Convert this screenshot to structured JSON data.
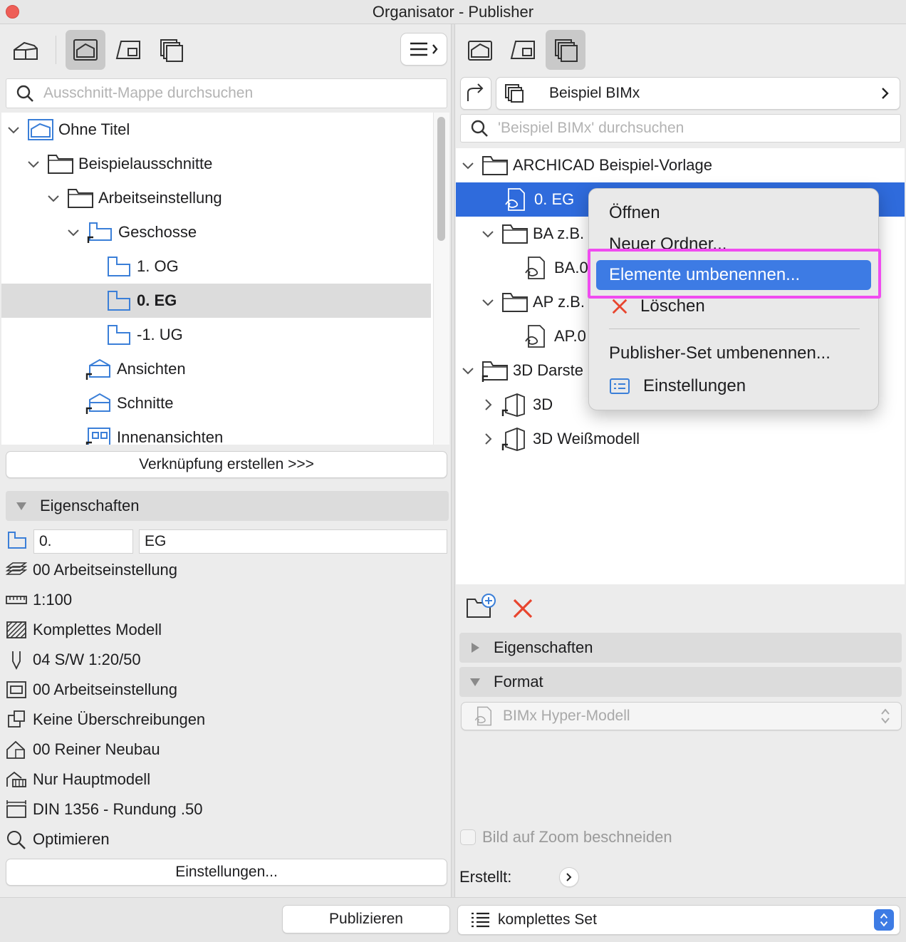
{
  "window": {
    "title": "Organisator - Publisher"
  },
  "left": {
    "search_placeholder": "Ausschnitt-Mappe durchsuchen",
    "tree": [
      {
        "label": "Ohne Titel",
        "level": 0,
        "icon": "project-icon",
        "chevron": "down"
      },
      {
        "label": "Beispielausschnitte",
        "level": 1,
        "icon": "folder-icon",
        "chevron": "down"
      },
      {
        "label": "Arbeitseinstellung",
        "level": 2,
        "icon": "folder-icon",
        "chevron": "down"
      },
      {
        "label": "Geschosse",
        "level": 3,
        "icon": "floorplan-shortcut-icon",
        "chevron": "down"
      },
      {
        "label": "1. OG",
        "level": 4,
        "icon": "floorplan-icon"
      },
      {
        "label": "0. EG",
        "level": 4,
        "icon": "floorplan-icon",
        "selected": true
      },
      {
        "label": "-1. UG",
        "level": 4,
        "icon": "floorplan-icon"
      },
      {
        "label": "Ansichten",
        "level": 3,
        "icon": "elevation-shortcut-icon"
      },
      {
        "label": "Schnitte",
        "level": 3,
        "icon": "section-shortcut-icon"
      },
      {
        "label": "Innenansichten",
        "level": 3,
        "icon": "interior-elevation-shortcut-icon"
      }
    ],
    "create_link_button": "Verknüpfung erstellen >>>",
    "properties_header": "Eigenschaften",
    "field_number": "0.",
    "field_name": "EG",
    "properties": [
      {
        "icon": "layer-combination-icon",
        "label": "00 Arbeitseinstellung"
      },
      {
        "icon": "scale-icon",
        "label": "1:100"
      },
      {
        "icon": "structure-display-icon",
        "label": "Komplettes Modell"
      },
      {
        "icon": "pen-set-icon",
        "label": "04 S/W 1:20/50"
      },
      {
        "icon": "model-view-icon",
        "label": "00 Arbeitseinstellung"
      },
      {
        "icon": "graphic-override-icon",
        "label": "Keine Überschreibungen"
      },
      {
        "icon": "renovation-filter-icon",
        "label": "00 Reiner Neubau"
      },
      {
        "icon": "design-options-icon",
        "label": "Nur Hauptmodell"
      },
      {
        "icon": "dimension-icon",
        "label": "DIN 1356 - Rundung .50"
      },
      {
        "icon": "zoom-icon",
        "label": "Optimieren"
      }
    ],
    "settings_button": "Einstellungen..."
  },
  "right": {
    "set_name": "Beispiel BIMx",
    "search_placeholder": "'Beispiel BIMx' durchsuchen",
    "tree": [
      {
        "label": "ARCHICAD Beispiel-Vorlage",
        "level": 0,
        "icon": "folder-icon",
        "chevron": "down"
      },
      {
        "label": "0. EG",
        "level": 1,
        "icon": "bimx-icon",
        "selected": true
      },
      {
        "label": "BA z.B.",
        "level": 1,
        "icon": "folder-icon",
        "chevron": "down"
      },
      {
        "label": "BA.0",
        "level": 2,
        "icon": "bimx-icon"
      },
      {
        "label": "AP z.B.",
        "level": 1,
        "icon": "folder-icon",
        "chevron": "down"
      },
      {
        "label": "AP.0",
        "level": 2,
        "icon": "bimx-icon"
      },
      {
        "label": "3D Darste",
        "level": 0,
        "icon": "folder-shortcut-icon",
        "chevron": "down"
      },
      {
        "label": "3D",
        "level": 1,
        "icon": "3d-shortcut-icon",
        "chevron": "right"
      },
      {
        "label": "3D Weißmodell",
        "level": 1,
        "icon": "3d-shortcut-icon",
        "chevron": "right"
      }
    ],
    "properties_header": "Eigenschaften",
    "format_header": "Format",
    "format_value": "BIMx Hyper-Modell",
    "crop_checkbox": "Bild auf Zoom beschneiden",
    "created_label": "Erstellt:"
  },
  "context_menu": {
    "items": [
      "Öffnen",
      "Neuer Ordner...",
      "Elemente umbenennen...",
      "Löschen",
      "Publisher-Set umbenennen...",
      "Einstellungen"
    ]
  },
  "footer": {
    "publish_button": "Publizieren",
    "set_select": "komplettes Set"
  },
  "colors": {
    "selection": "#2f6bdc",
    "menu_highlight": "#3d7be4",
    "annotation": "#f04cf0",
    "delete": "#e8452e",
    "icon_blue": "#3b7fd8"
  }
}
